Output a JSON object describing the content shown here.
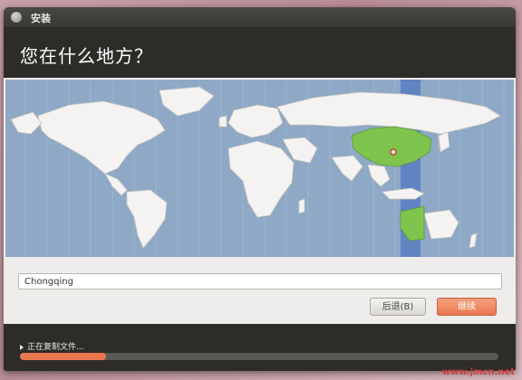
{
  "window": {
    "title": "安装"
  },
  "page": {
    "heading": "您在什么地方？"
  },
  "location": {
    "value": "Chongqing"
  },
  "buttons": {
    "back_label": "后退(B)",
    "continue_label": "继续"
  },
  "progress": {
    "label": "正在复制文件...",
    "fraction": 0.18
  },
  "colors": {
    "accent": "#e9784f",
    "ocean": "#8ea8c6",
    "highlight": "#7fc44c",
    "timezone_band": "#5b7fc1"
  },
  "map": {
    "selected_country": "China",
    "selected_city_marker": "Chongqing"
  },
  "watermark": {
    "text": "www.jmcn.net"
  }
}
